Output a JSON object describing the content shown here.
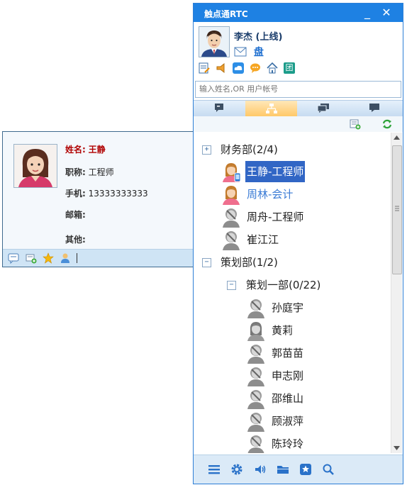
{
  "card": {
    "name_label": "姓名:",
    "name_value": "王静",
    "title_label": "职称:",
    "title_value": "工程师",
    "phone_label": "手机:",
    "phone_value": "13333333333",
    "email_label": "邮箱:",
    "email_value": "",
    "other_label": "其他:",
    "other_value": "",
    "toolbar_icons": [
      "message-icon",
      "card-add-icon",
      "star-icon",
      "user-group-icon"
    ]
  },
  "window": {
    "title": "触点通RTC",
    "minimize_label": "_",
    "close_label": "✕",
    "user_name": "李杰",
    "user_status": "(上线)",
    "mini_icons": [
      "mail-icon",
      "disk-icon"
    ],
    "disk_label": "盘",
    "app_icons": [
      "note-icon",
      "broadcast-icon",
      "cloud-icon",
      "chat-bubble-icon",
      "home-icon",
      "app-icon"
    ],
    "app_icon_letter": "团",
    "search_placeholder": "输入姓名,OR 用户帐号",
    "tabs": [
      "tab-recent",
      "tab-org",
      "tab-groups",
      "tab-discussion"
    ],
    "action_icons": [
      "add-contact-icon",
      "refresh-icon"
    ]
  },
  "tree": {
    "dept1": {
      "label": "财务部(2/4)",
      "toggle": "+"
    },
    "members1": [
      {
        "label": "王静-工程师"
      },
      {
        "label": "周林-会计"
      },
      {
        "label": "周舟-工程师"
      },
      {
        "label": "崔江江"
      }
    ],
    "dept2": {
      "label": "策划部(1/2)",
      "toggle": "−"
    },
    "subdept": {
      "label": "策划一部(0/22)",
      "toggle": "−"
    },
    "members2": [
      {
        "label": "孙庭宇"
      },
      {
        "label": "黄莉"
      },
      {
        "label": "郭苗苗"
      },
      {
        "label": "申志刚"
      },
      {
        "label": "邵维山"
      },
      {
        "label": "顾淑萍"
      },
      {
        "label": "陈玲玲"
      }
    ]
  },
  "footer": {
    "icons": [
      "menu-icon",
      "settings-icon",
      "volume-icon",
      "folder-icon",
      "favorites-icon",
      "search-icon"
    ]
  },
  "colors": {
    "titlebar": "#1e81e3",
    "selection": "#3166c5",
    "name_red": "#b00000",
    "online_blue": "#3a7bd5"
  }
}
